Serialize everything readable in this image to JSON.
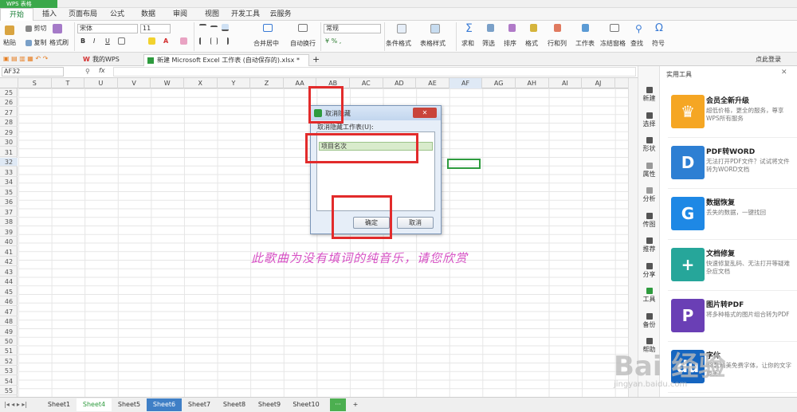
{
  "app": {
    "logo_text": "WPS 表格"
  },
  "menu": {
    "items": [
      "开始",
      "插入",
      "页面布局",
      "公式",
      "数据",
      "审阅",
      "视图",
      "开发工具",
      "云服务"
    ]
  },
  "ribbon": {
    "paste": "粘贴",
    "cut": "剪切",
    "copy": "复制",
    "format_painter": "格式刷",
    "font_name": "宋体",
    "font_size": "11",
    "bold": "B",
    "italic": "I",
    "underline": "U",
    "merge_center": "合并居中",
    "wrap_text": "自动换行",
    "number_format": "常规",
    "cond_format": "条件格式",
    "table_style": "表格样式",
    "sum": "求和",
    "filter": "筛选",
    "sort": "排序",
    "format": "格式",
    "rows_cols": "行和列",
    "worksheet": "工作表",
    "freeze": "冻结窗格",
    "find": "查找",
    "symbol": "符号"
  },
  "doc_tabs": {
    "my_wps": "我的WPS",
    "file": "新建 Microsoft Excel 工作表 (自动保存的).xlsx *",
    "add": "+",
    "login": "点此登录"
  },
  "formula_bar": {
    "cell_ref": "AF32",
    "fx": "fx"
  },
  "columns": [
    "S",
    "T",
    "U",
    "V",
    "W",
    "X",
    "Y",
    "Z",
    "AA",
    "AB",
    "AC",
    "AD",
    "AE",
    "AF",
    "AG",
    "AH",
    "AI",
    "AJ"
  ],
  "rows": [
    "25",
    "26",
    "27",
    "28",
    "29",
    "30",
    "31",
    "32",
    "33",
    "34",
    "35",
    "36",
    "37",
    "38",
    "39",
    "40",
    "41",
    "42",
    "43",
    "44",
    "45",
    "46",
    "47",
    "48",
    "49",
    "50",
    "51",
    "52",
    "53",
    "54",
    "55"
  ],
  "dialog": {
    "title": "取消隐藏",
    "label": "取消隐藏工作表(U):",
    "list_items": [
      "项目名次"
    ],
    "ok": "确定",
    "cancel": "取消",
    "close": "✕"
  },
  "annotation": "此歌曲为没有填词的纯音乐，请您欣赏",
  "sheets": [
    "Sheet1",
    "Sheet4",
    "Sheet5",
    "Sheet6",
    "Sheet7",
    "Sheet8",
    "Sheet9",
    "Sheet10"
  ],
  "active_sheet": "Sheet4",
  "highlighted_sheet": "Sheet6",
  "sheet_more": "···",
  "sheet_add": "+",
  "right_rail": [
    "新建",
    "选择",
    "形状",
    "属性",
    "分析",
    "传图",
    "推荐",
    "分享",
    "工具",
    "备份",
    "帮助"
  ],
  "tool_panel": {
    "title": "实用工具",
    "cards": [
      {
        "title": "会员全新升级",
        "desc": "超低价格，更全的服务，尊享WPS所有服务",
        "icon": "crown-icon",
        "color": "#f5a623"
      },
      {
        "title": "PDF转WORD",
        "desc": "无法打开PDF文件？试试将文件转为WORD文档",
        "icon": "pdf-icon",
        "color": "#2d7fd3"
      },
      {
        "title": "数据恢复",
        "desc": "丢失的数据，一键找回",
        "icon": "recover-icon",
        "color": "#1e88e5"
      },
      {
        "title": "文档修复",
        "desc": "快速修复乱码、无法打开等疑难杂症文档",
        "icon": "repair-icon",
        "color": "#26a69a"
      },
      {
        "title": "图片转PDF",
        "desc": "将多种格式的图片组合转为PDF",
        "icon": "image-pdf-icon",
        "color": "#6a3fb5"
      },
      {
        "title": "字体",
        "desc": "88款精美免费字体，让你的文字更美！",
        "icon": "font-icon",
        "color": "#1565c0"
      }
    ]
  },
  "watermark": "Bai 经验",
  "watermark_sub": "jingyan.baidu.com"
}
